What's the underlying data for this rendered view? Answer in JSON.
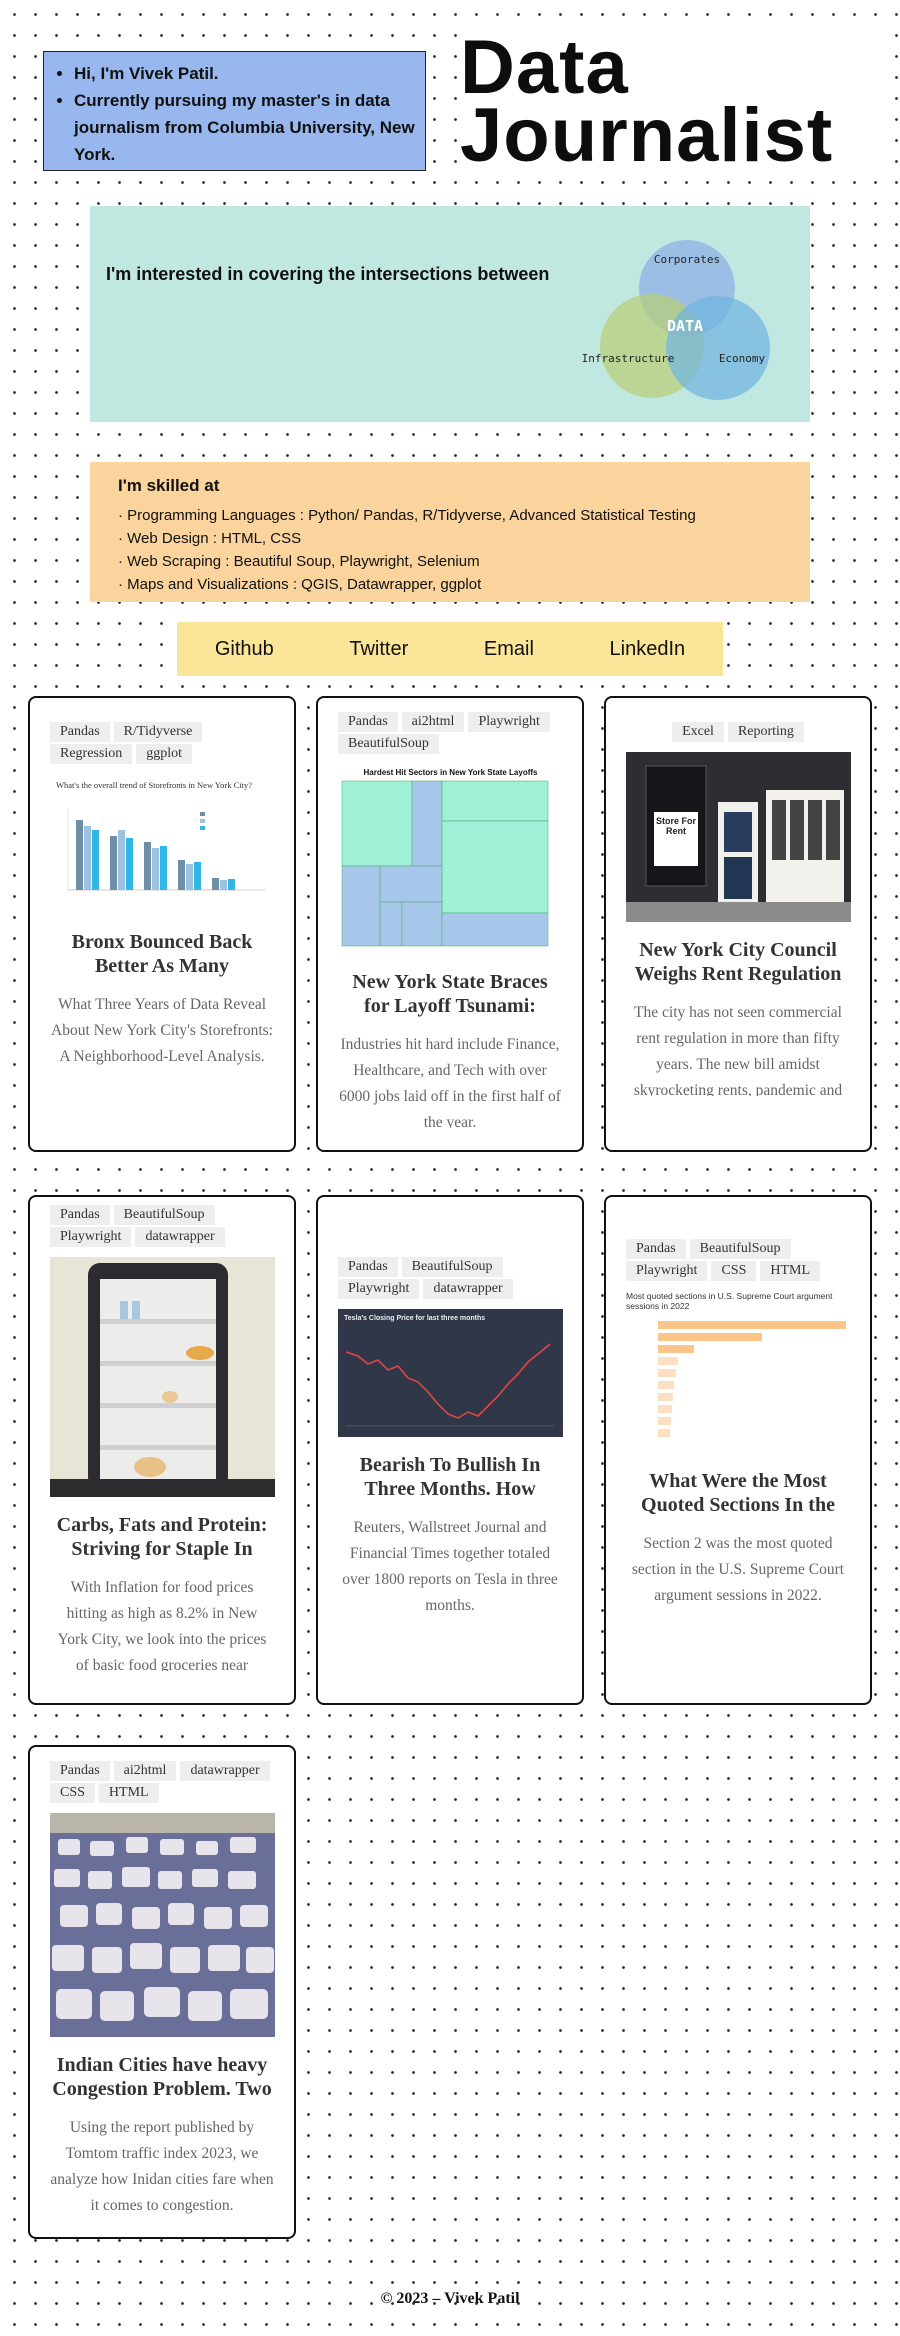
{
  "intro": {
    "lines": [
      "Hi, I'm Vivek Patil.",
      "Currently pursuing my master's in data journalism from Columbia University, New York."
    ]
  },
  "hero": {
    "title_line1": "Data",
    "title_line2": "Journalist"
  },
  "interest": {
    "text": "I'm interested in covering the intersections between",
    "venn": {
      "top": "Corporates",
      "left": "Infrastructure",
      "right": "Economy",
      "center": "DATA"
    }
  },
  "skills": {
    "title": "I'm skilled at",
    "lines": [
      "· Programming Languages : Python/ Pandas, R/Tidyverse, Advanced Statistical Testing",
      "· Web Design : HTML, CSS",
      "· Web Scraping : Beautiful Soup, Playwright, Selenium",
      "· Maps and Visualizations : QGIS, Datawrapper, ggplot"
    ]
  },
  "links": [
    "Github",
    "Twitter",
    "Email",
    "LinkedIn"
  ],
  "cards": [
    {
      "tags": [
        "Pandas",
        "R/Tidyverse",
        "Regression",
        "ggplot"
      ],
      "thumb_title": "What's the overall trend of Storefronts in New York City?",
      "title": "Bronx Bounced Back Better As Many",
      "desc": "What Three Years of Data Reveal About New York City's Storefronts: A Neighborhood-Level Analysis."
    },
    {
      "tags": [
        "Pandas",
        "ai2html",
        "Playwright",
        "BeautifulSoup"
      ],
      "thumb_title": "Hardest Hit Sectors in New York State Layoffs",
      "title": "New York State Braces for Layoff Tsunami:",
      "desc": "Industries hit hard include Finance, Healthcare, and Tech with over 6000 jobs laid off in the first half of the year."
    },
    {
      "tags": [
        "Excel",
        "Reporting"
      ],
      "thumb_sign": "Store For Rent",
      "title": "New York City Council Weighs Rent Regulation",
      "desc": "The city has not seen commercial rent regulation in more than fifty years. The new bill amidst skyrocketing rents, pandemic and"
    },
    {
      "tags": [
        "Pandas",
        "BeautifulSoup",
        "Playwright",
        "datawrapper"
      ],
      "title": "Carbs, Fats and Protein: Striving for Staple In",
      "desc": "With Inflation for food prices hitting as high as 8.2% in New York City, we look into the prices of basic food groceries near"
    },
    {
      "tags": [
        "Pandas",
        "BeautifulSoup",
        "Playwright",
        "datawrapper"
      ],
      "thumb_title": "Tesla's Closing Price for last three months",
      "title": "Bearish To Bullish In Three Months. How",
      "desc": "Reuters, Wallstreet Journal and Financial Times together totaled over 1800 reports on Tesla in three months."
    },
    {
      "tags": [
        "Pandas",
        "BeautifulSoup",
        "Playwright",
        "CSS",
        "HTML"
      ],
      "thumb_title": "Most quoted sections in U.S. Supreme Court argument sessions in 2022",
      "title": "What Were the Most Quoted Sections In the",
      "desc": "Section 2 was the most quoted section in the U.S. Supreme Court argument sessions in 2022."
    },
    {
      "tags": [
        "Pandas",
        "ai2html",
        "datawrapper",
        "CSS",
        "HTML"
      ],
      "title": "Indian Cities have heavy Congestion Problem. Two",
      "desc": "Using the report published by Tomtom traffic index 2023, we analyze how Inidan cities fare when it comes to congestion."
    }
  ],
  "footer": "© 2023 – Vivek Patil"
}
